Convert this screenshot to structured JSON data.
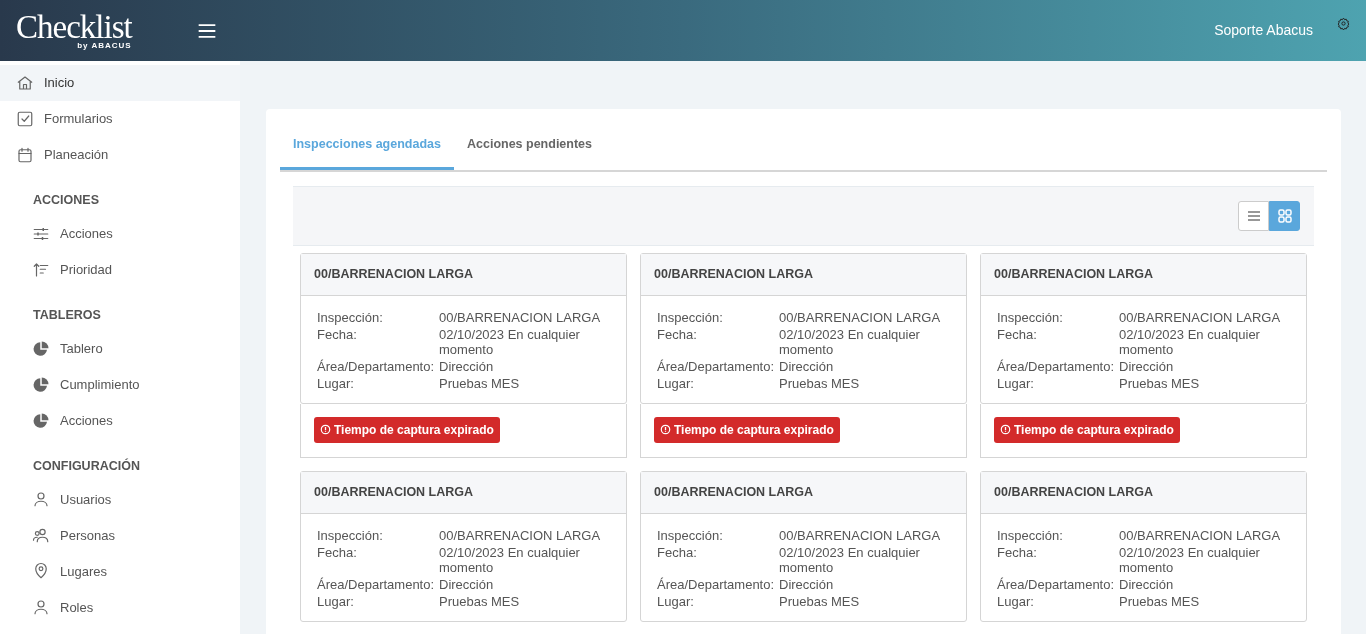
{
  "header": {
    "logo": "Checklist",
    "logo_sub": "by ABACUS",
    "user": "Soporte Abacus"
  },
  "sidebar": {
    "items": [
      {
        "label": "Inicio",
        "selected": true
      },
      {
        "label": "Formularios",
        "selected": false
      },
      {
        "label": "Planeación",
        "selected": false
      }
    ],
    "sections": [
      {
        "title": "ACCIONES",
        "items": [
          {
            "label": "Acciones",
            "selected": false
          },
          {
            "label": "Prioridad",
            "selected": false
          }
        ]
      },
      {
        "title": "TABLEROS",
        "items": [
          {
            "label": "Tablero",
            "selected": false
          },
          {
            "label": "Cumplimiento",
            "selected": false
          },
          {
            "label": "Acciones",
            "selected": false
          }
        ]
      },
      {
        "title": "CONFIGURACIÓN",
        "items": [
          {
            "label": "Usuarios",
            "selected": false
          },
          {
            "label": "Personas",
            "selected": false
          },
          {
            "label": "Lugares",
            "selected": false
          },
          {
            "label": "Roles",
            "selected": false
          }
        ]
      }
    ]
  },
  "tabs": [
    {
      "label": "Inspecciones agendadas",
      "selected": true
    },
    {
      "label": "Acciones pendientes",
      "selected": false
    }
  ],
  "view_toggle": [
    {
      "kind": "list",
      "selected": false
    },
    {
      "kind": "grid",
      "selected": true
    }
  ],
  "cards": [
    {
      "title": "00/BARRENACION LARGA",
      "fields": [
        {
          "label": "Inspección:",
          "value": "00/BARRENACION LARGA"
        },
        {
          "label": "Fecha:",
          "value": "02/10/2023 En cualquier momento"
        },
        {
          "label": "Área/Departamento:",
          "value": "Dirección"
        },
        {
          "label": "Lugar:",
          "value": "Pruebas MES"
        }
      ],
      "badge": "Tiempo de captura expirado"
    },
    {
      "title": "00/BARRENACION LARGA",
      "fields": [
        {
          "label": "Inspección:",
          "value": "00/BARRENACION LARGA"
        },
        {
          "label": "Fecha:",
          "value": "02/10/2023 En cualquier momento"
        },
        {
          "label": "Área/Departamento:",
          "value": "Dirección"
        },
        {
          "label": "Lugar:",
          "value": "Pruebas MES"
        }
      ],
      "badge": "Tiempo de captura expirado"
    },
    {
      "title": "00/BARRENACION LARGA",
      "fields": [
        {
          "label": "Inspección:",
          "value": "00/BARRENACION LARGA"
        },
        {
          "label": "Fecha:",
          "value": "02/10/2023 En cualquier momento"
        },
        {
          "label": "Área/Departamento:",
          "value": "Dirección"
        },
        {
          "label": "Lugar:",
          "value": "Pruebas MES"
        }
      ],
      "badge": "Tiempo de captura expirado"
    },
    {
      "title": "00/BARRENACION LARGA",
      "fields": [
        {
          "label": "Inspección:",
          "value": "00/BARRENACION LARGA"
        },
        {
          "label": "Fecha:",
          "value": "02/10/2023 En cualquier momento"
        },
        {
          "label": "Área/Departamento:",
          "value": "Dirección"
        },
        {
          "label": "Lugar:",
          "value": "Pruebas MES"
        }
      ]
    },
    {
      "title": "00/BARRENACION LARGA",
      "fields": [
        {
          "label": "Inspección:",
          "value": "00/BARRENACION LARGA"
        },
        {
          "label": "Fecha:",
          "value": "02/10/2023 En cualquier momento"
        },
        {
          "label": "Área/Departamento:",
          "value": "Dirección"
        },
        {
          "label": "Lugar:",
          "value": "Pruebas MES"
        }
      ]
    },
    {
      "title": "00/BARRENACION LARGA",
      "fields": [
        {
          "label": "Inspección:",
          "value": "00/BARRENACION LARGA"
        },
        {
          "label": "Fecha:",
          "value": "02/10/2023 En cualquier momento"
        },
        {
          "label": "Área/Departamento:",
          "value": "Dirección"
        },
        {
          "label": "Lugar:",
          "value": "Pruebas MES"
        }
      ]
    }
  ]
}
